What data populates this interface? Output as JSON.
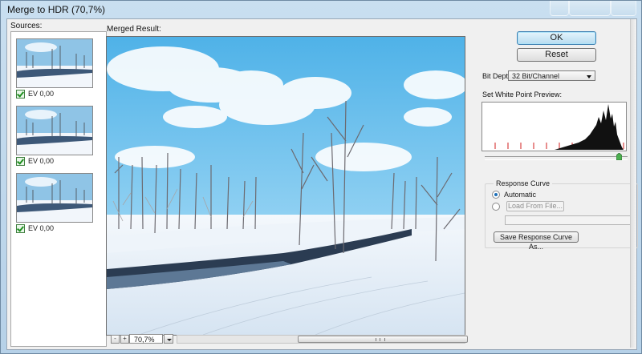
{
  "window": {
    "title": "Merge to HDR (70,7%)"
  },
  "sources": {
    "label": "Sources:",
    "items": [
      {
        "ev": "EV 0,00",
        "checked": true
      },
      {
        "ev": "EV 0,00",
        "checked": true
      },
      {
        "ev": "EV 0,00",
        "checked": true
      }
    ]
  },
  "preview": {
    "label": "Merged Result:",
    "zoom": "70,7%",
    "zoom_out_glyph": "-",
    "zoom_in_glyph": "+"
  },
  "controls": {
    "ok_label": "OK",
    "reset_label": "Reset",
    "bit_depth_label": "Bit Depth:",
    "bit_depth_value": "32 Bit/Channel",
    "white_point_label": "Set White Point Preview:",
    "white_point_fraction": 0.94,
    "response_curve": {
      "title": "Response Curve",
      "automatic_label": "Automatic",
      "load_label": "Load From File...",
      "save_label": "Save Response Curve As...",
      "selected": "Automatic"
    }
  },
  "colors": {
    "accent": "#3c7fb1",
    "histogram_tick": "#d21e1e"
  }
}
